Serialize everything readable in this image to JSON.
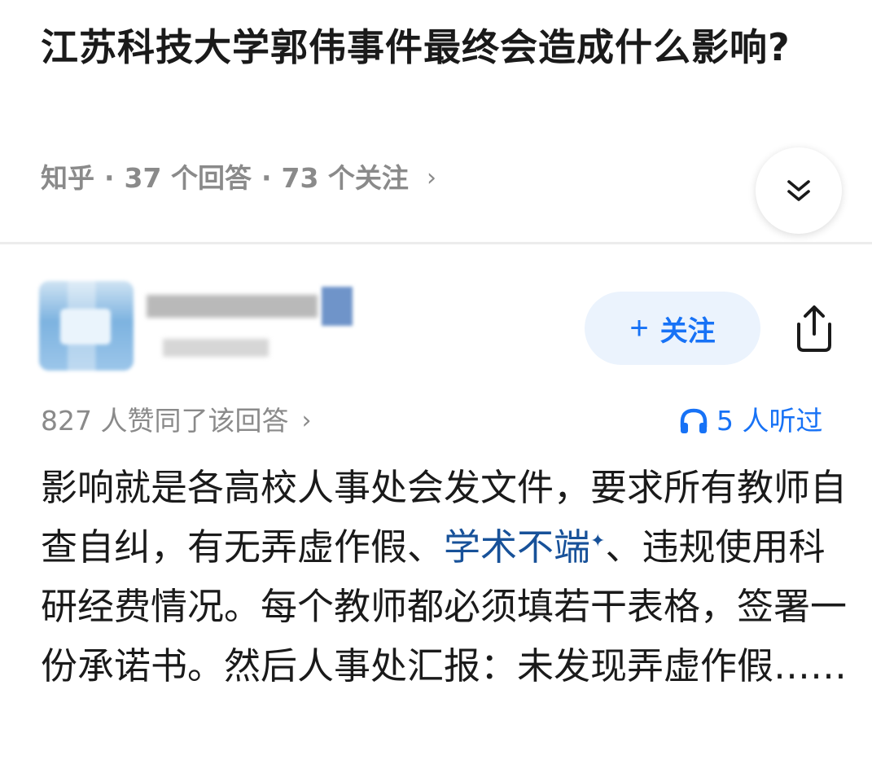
{
  "question": {
    "title": "江苏科技大学郭伟事件最终会造成什么影响?",
    "source": "知乎",
    "answers": "37 个回答",
    "followers": "73 个关注",
    "chevron": "›"
  },
  "expand_icon": "double-chevron-down-icon",
  "author": {
    "follow_label": "关注",
    "follow_plus": "+",
    "share_icon": "share-icon"
  },
  "answer": {
    "likes": "827 人赞同了该回答",
    "likes_chevron": "›",
    "listened": "5 人听过",
    "listen_icon": "headphones-icon",
    "text_before": "影响就是各高校人事处会发文件，要求所有教师自查自纠，有无弄虚作假、",
    "keyword": "学术不端",
    "keyword_mark": "✦",
    "text_after": "、违规使用科研经费情况。每个教师都必须填若干表格，签署一份承诺书。然后人事处汇报：未发现弄虚作假……"
  },
  "colors": {
    "accent": "#1772f6",
    "keyword": "#175199",
    "meta_gray": "#8a8a8a",
    "follow_bg": "#ebf3fd"
  }
}
